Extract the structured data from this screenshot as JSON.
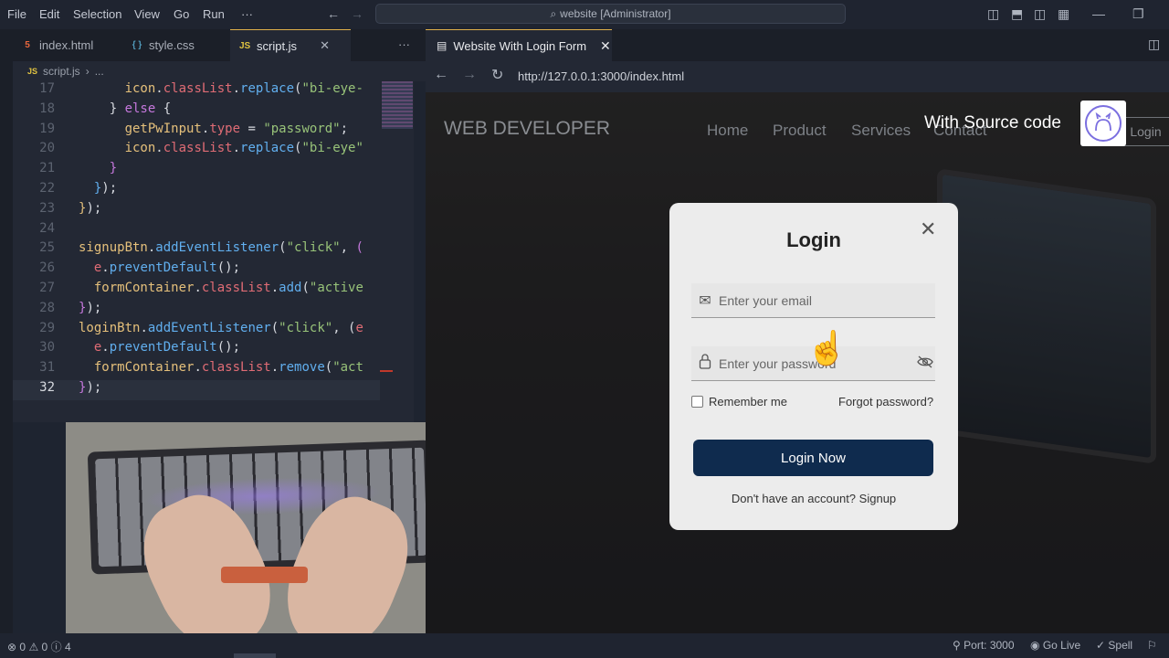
{
  "menu": [
    "File",
    "Edit",
    "Selection",
    "View",
    "Go",
    "Run",
    "···"
  ],
  "command_center": "website [Administrator]",
  "editor_tabs": [
    {
      "label": "index.html",
      "icon": "5",
      "color": "#e8663d"
    },
    {
      "label": "style.css",
      "icon": "{ }",
      "color": "#519aba"
    },
    {
      "label": "script.js",
      "icon": "JS",
      "color": "#e0c341"
    }
  ],
  "more_tabs": "···",
  "breadcrumb": {
    "file": "script.js",
    "sep": "›",
    "rest": "..."
  },
  "code_lines": [
    {
      "n": "17",
      "html": "      <span style='color:#e5c07b'>icon</span>.<span style='color:#e06c75'>classList</span>.<span style='color:#61afef'>replace</span>(<span style='color:#98c379'>\"bi-eye-</span>"
    },
    {
      "n": "18",
      "html": "    } <span style='color:#c678dd'>else</span> {"
    },
    {
      "n": "19",
      "html": "      <span style='color:#e5c07b'>getPwInput</span>.<span style='color:#e06c75'>type</span> = <span style='color:#98c379'>\"password\"</span>;"
    },
    {
      "n": "20",
      "html": "      <span style='color:#e5c07b'>icon</span>.<span style='color:#e06c75'>classList</span>.<span style='color:#61afef'>replace</span>(<span style='color:#98c379'>\"bi-eye\"</span>"
    },
    {
      "n": "21",
      "html": "    <span style='color:#c678dd'>}</span>"
    },
    {
      "n": "22",
      "html": "  <span style='color:#61afef'>}</span>);"
    },
    {
      "n": "23",
      "html": "<span style='color:#e5c07b'>}</span>);"
    },
    {
      "n": "24",
      "html": ""
    },
    {
      "n": "25",
      "html": "<span style='color:#e5c07b'>signupBtn</span>.<span style='color:#61afef'>addEventListener</span>(<span style='color:#98c379'>\"click\"</span>, <span style='color:#c678dd'>(</span>"
    },
    {
      "n": "26",
      "html": "  <span style='color:#e06c75'>e</span>.<span style='color:#61afef'>preventDefault</span>();"
    },
    {
      "n": "27",
      "html": "  <span style='color:#e5c07b'>formContainer</span>.<span style='color:#e06c75'>classList</span>.<span style='color:#61afef'>add</span>(<span style='color:#98c379'>\"active</span>"
    },
    {
      "n": "28",
      "html": "<span style='color:#c678dd'>}</span>);"
    },
    {
      "n": "29",
      "html": "<span style='color:#e5c07b'>loginBtn</span>.<span style='color:#61afef'>addEventListener</span>(<span style='color:#98c379'>\"click\"</span>, (<span style='color:#e06c75'>e</span>"
    },
    {
      "n": "30",
      "html": "  <span style='color:#e06c75'>e</span>.<span style='color:#61afef'>preventDefault</span>();"
    },
    {
      "n": "31",
      "html": "  <span style='color:#e5c07b'>formContainer</span>.<span style='color:#e06c75'>classList</span>.<span style='color:#61afef'>remove</span>(<span style='color:#98c379'>\"act</span>"
    },
    {
      "n": "32",
      "html": "<span style='color:#c678dd'>}</span>);"
    }
  ],
  "current_line": "32",
  "preview": {
    "tab_label": "Website With Login Form",
    "url": "http://127.0.0.1:3000/index.html"
  },
  "site": {
    "logo": "WEB DEVELOPER",
    "nav": [
      "Home",
      "Product",
      "Services",
      "Contact"
    ],
    "login_button": "Login",
    "watermark": "With Source code"
  },
  "login_form": {
    "title": "Login",
    "email_placeholder": "Enter your email",
    "password_placeholder": "Enter your password",
    "remember": "Remember me",
    "forgot": "Forgot password?",
    "submit": "Login Now",
    "signup_prompt": "Don't have an account?",
    "signup_link": "Signup"
  },
  "status": {
    "errors": "0",
    "warnings": "0",
    "info": "4",
    "port": "Port: 3000",
    "go_live": "Go Live",
    "spell": "Spell"
  }
}
